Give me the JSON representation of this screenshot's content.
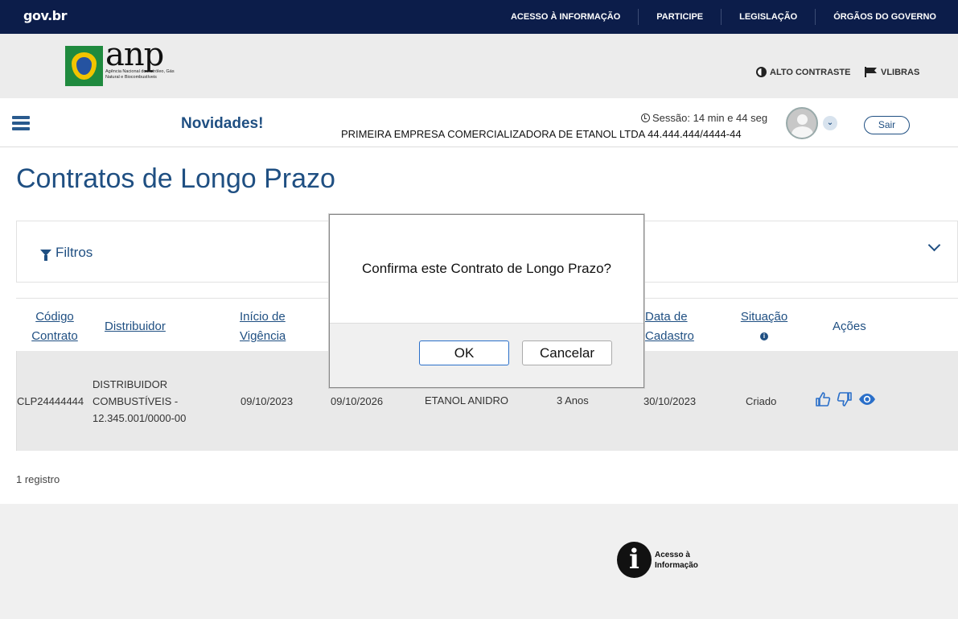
{
  "govbar": {
    "logo": "gov.br",
    "links": [
      "ACESSO À INFORMAÇÃO",
      "PARTICIPE",
      "LEGISLAÇÃO",
      "ÓRGÃOS DO GOVERNO"
    ]
  },
  "header": {
    "logo_text": "anp",
    "logo_subtitle": "Agência Nacional do Petróleo, Gás Natural e Biocombustíveis",
    "alto_contraste": "ALTO CONTRASTE",
    "vlibras": "VLIBRAS"
  },
  "navbar": {
    "title": "Novidades!",
    "session": "Sessão: 14 min e 44 seg",
    "company": "PRIMEIRA EMPRESA COMERCIALIZADORA DE ETANOL LTDA 44.444.444/4444-44",
    "logout": "Sair"
  },
  "page": {
    "title": "Contratos de Longo Prazo",
    "filters_label": "Filtros",
    "records": "1 registro"
  },
  "table": {
    "headers": {
      "codigo_1": "Código",
      "codigo_2": "Contrato",
      "distribuidor": "Distribuidor",
      "inicio_1": "Início de",
      "inicio_2": "Vigência",
      "data_cadastro_1": "Data de",
      "data_cadastro_2": "Cadastro",
      "situacao": "Situação",
      "acoes": "Ações"
    },
    "row": {
      "codigo": "CLP24444444",
      "distribuidor_1": "DISTRIBUIDOR",
      "distribuidor_2": "COMBUSTÍVEIS -",
      "distribuidor_3": "12.345.001/0000-00",
      "inicio": "09/10/2023",
      "fim": "09/10/2026",
      "produto": "ETANOL ANIDRO",
      "prazo": "3 Anos",
      "data_cadastro": "30/10/2023",
      "situacao": "Criado"
    }
  },
  "footer": {
    "acesso_1": "Acesso à",
    "acesso_2": "Informação"
  },
  "modal": {
    "message": "Confirma este Contrato de Longo Prazo?",
    "ok": "OK",
    "cancel": "Cancelar"
  },
  "colors": {
    "govbar": "#0c1d4a",
    "primary": "#1f4f82",
    "header_bg": "#ececec",
    "row_bg": "#e9e9e9"
  }
}
